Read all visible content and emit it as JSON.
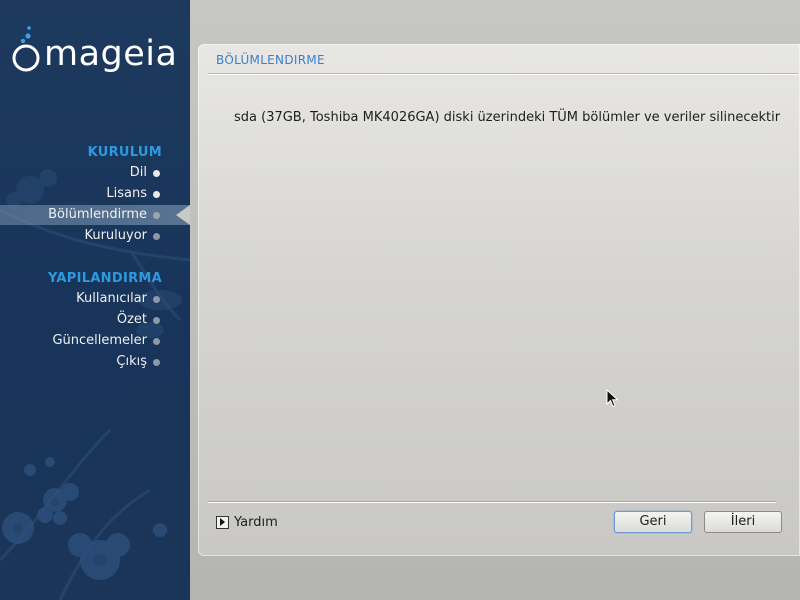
{
  "sidebar": {
    "logo_text": "mageia",
    "sections": [
      {
        "title": "KURULUM",
        "steps": [
          {
            "label": "Dil",
            "state": "done"
          },
          {
            "label": "Lisans",
            "state": "done"
          },
          {
            "label": "Bölümlendirme",
            "state": "active"
          },
          {
            "label": "Kuruluyor",
            "state": "pending"
          }
        ]
      },
      {
        "title": "YAPILANDIRMA",
        "steps": [
          {
            "label": "Kullanıcılar",
            "state": "pending"
          },
          {
            "label": "Özet",
            "state": "pending"
          },
          {
            "label": "Güncellemeler",
            "state": "pending"
          },
          {
            "label": "Çıkış",
            "state": "pending"
          }
        ]
      }
    ]
  },
  "panel": {
    "title": "BÖLÜMLENDIRME",
    "message": "sda (37GB, Toshiba MK4026GA) diski üzerindeki TÜM bölümler ve veriler silinecektir"
  },
  "footer": {
    "help_label": "Yardım",
    "back_label": "Geri",
    "next_label": "İleri"
  },
  "icons": {
    "logo": "mageia-bubbles-icon",
    "help": "expander-triangle-icon",
    "cursor": "mouse-pointer-icon"
  },
  "colors": {
    "sidebar_bg": "#1d3a5e",
    "section_title": "#2d9ae0",
    "panel_title": "#3a7fd0",
    "focus_ring": "#6f9bd4"
  }
}
